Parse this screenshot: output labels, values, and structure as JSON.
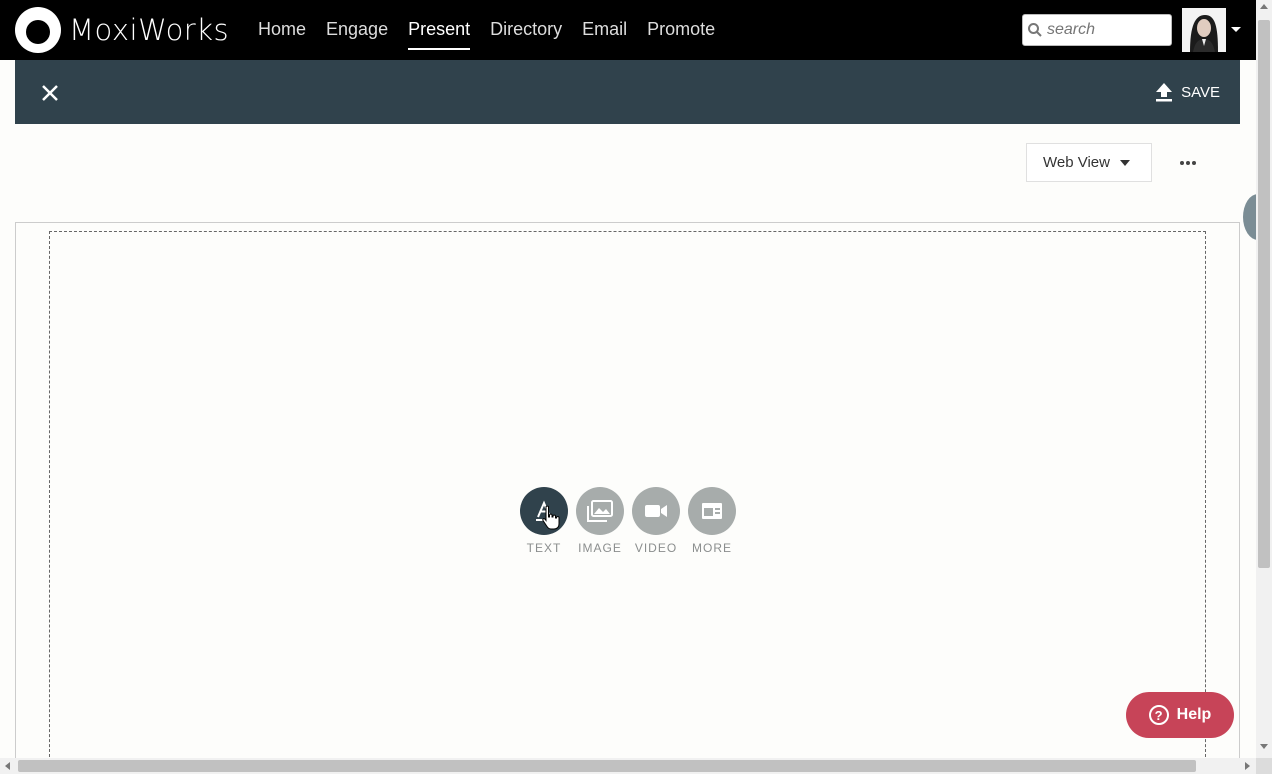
{
  "brand": {
    "name": "MoxiWorks"
  },
  "nav": {
    "items": [
      {
        "label": "Home",
        "active": false
      },
      {
        "label": "Engage",
        "active": false
      },
      {
        "label": "Present",
        "active": true
      },
      {
        "label": "Directory",
        "active": false
      },
      {
        "label": "Email",
        "active": false
      },
      {
        "label": "Promote",
        "active": false
      }
    ]
  },
  "search": {
    "placeholder": "search"
  },
  "editbar": {
    "save_label": "SAVE"
  },
  "view": {
    "selected": "Web View"
  },
  "tools": [
    {
      "label": "TEXT",
      "icon": "text-icon",
      "active": true
    },
    {
      "label": "IMAGE",
      "icon": "image-icon",
      "active": false
    },
    {
      "label": "VIDEO",
      "icon": "video-icon",
      "active": false
    },
    {
      "label": "MORE",
      "icon": "more-blocks-icon",
      "active": false
    }
  ],
  "help": {
    "label": "Help"
  },
  "colors": {
    "nav_bg": "#000000",
    "editbar_bg": "#30424c",
    "tool_active": "#30424c",
    "tool_inactive": "#a7acab",
    "help_bg": "#c74458"
  }
}
